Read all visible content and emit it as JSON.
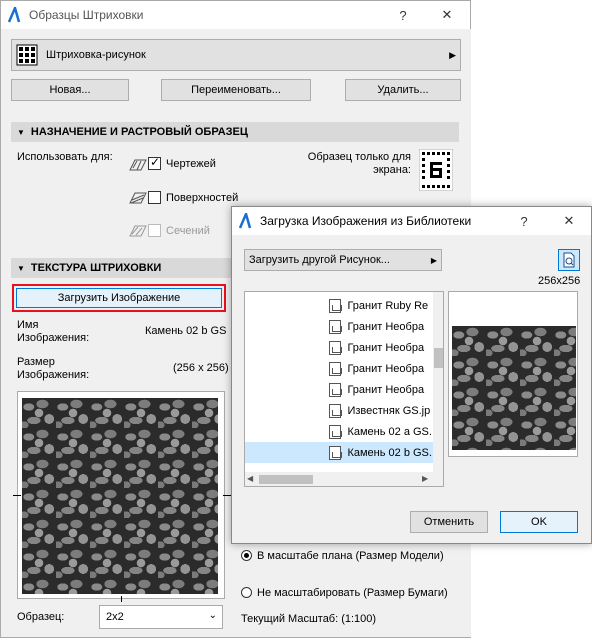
{
  "main": {
    "title": "Образцы Штриховки",
    "help": "?",
    "close": "✕",
    "selector_label": "Штриховка-рисунок",
    "buttons": {
      "new": "Новая...",
      "rename": "Переименовать...",
      "delete": "Удалить..."
    },
    "section1": "НАЗНАЧЕНИЕ И РАСТРОВЫЙ ОБРАЗЕЦ",
    "use_for": "Использовать для:",
    "use_options": [
      {
        "label": "Чертежей",
        "checked": true
      },
      {
        "label": "Поверхностей",
        "checked": false
      },
      {
        "label": "Сечений",
        "checked": false
      }
    ],
    "screen_only": "Образец только для экрана:",
    "section2": "ТЕКСТУРА ШТРИХОВКИ",
    "load_image": "Загрузить Изображение",
    "image_name_label": "Имя Изображения:",
    "image_name_value": "Камень 02 b GS",
    "image_size_label": "Размер Изображения:",
    "image_size_value": "(256 x 256)",
    "scale_options": [
      {
        "label": "В масштабе плана (Размер Модели)",
        "selected": true
      },
      {
        "label": "Не масштабировать (Размер Бумаги)",
        "selected": false
      }
    ],
    "sample_label": "Образец:",
    "sample_value": "2x2",
    "current_scale": "Текущий Масштаб: (1:100)"
  },
  "dialog": {
    "title": "Загрузка Изображения из Библиотеки",
    "help": "?",
    "close": "✕",
    "load_other": "Загрузить другой Рисунок...",
    "preview_size": "256x256",
    "files": [
      "Гранит Ruby Re",
      "Гранит Необра",
      "Гранит Необра",
      "Гранит Необра",
      "Гранит Необра",
      "Известняк GS.jp",
      "Камень 02 a GS.",
      "Камень 02 b GS."
    ],
    "selected_index": 7,
    "cancel": "Отменить",
    "ok": "OK"
  },
  "colors": {
    "accent": "#0078d7",
    "highlight_red": "#e81123",
    "selection": "#cce8ff"
  }
}
